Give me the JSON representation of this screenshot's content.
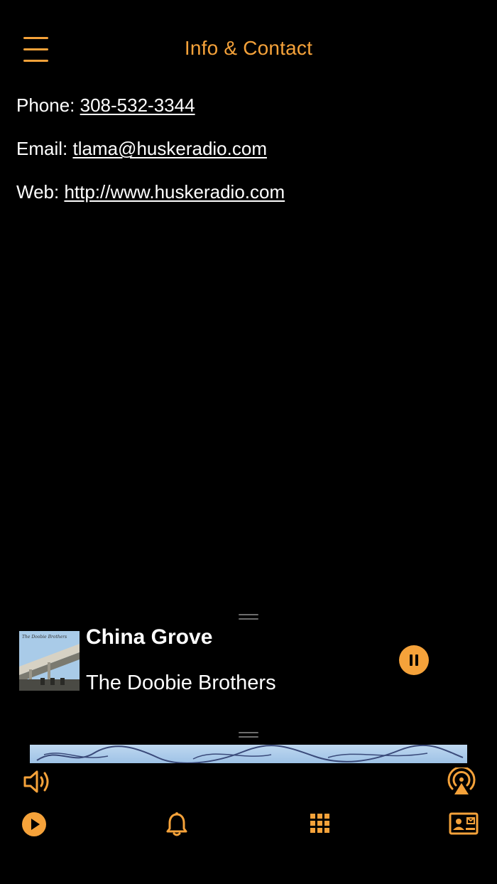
{
  "header": {
    "title": "Info & Contact",
    "menu_icon": "hamburger-menu-icon"
  },
  "contact": {
    "phone_label": "Phone: ",
    "phone_value": "308-532-3344",
    "email_label": "Email: ",
    "email_value": "tlama@huskeradio.com",
    "web_label": "Web: ",
    "web_value": "http://www.huskeradio.com"
  },
  "now_playing": {
    "title": "China Grove",
    "artist": "The Doobie Brothers",
    "album_art_icon": "album-art",
    "control_icon": "pause-icon"
  },
  "banner": {
    "icon": "album-banner-image"
  },
  "toolbar": {
    "top_left_icon": "volume-icon",
    "top_right_icon": "airplay-icon",
    "items": [
      {
        "icon": "play-icon"
      },
      {
        "icon": "bell-icon"
      },
      {
        "icon": "grid-icon"
      },
      {
        "icon": "contact-card-icon"
      }
    ]
  },
  "colors": {
    "accent": "#f5a23a",
    "background": "#000000",
    "text": "#ffffff"
  }
}
